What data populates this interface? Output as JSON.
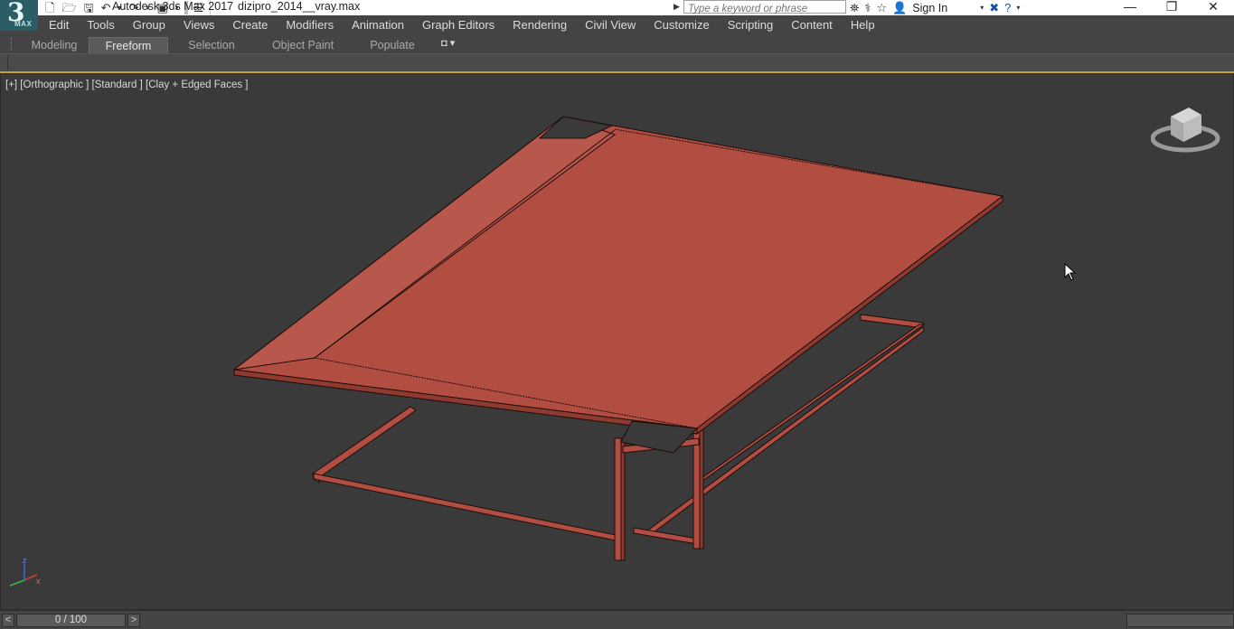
{
  "window": {
    "app_title": "Autodesk 3ds Max 2017",
    "file_name": "dizipro_2014__vray.max",
    "logo_big": "3",
    "logo_small": "MAX",
    "search_placeholder": "Type a keyword or phrase",
    "sign_in_label": "Sign In",
    "minimize_glyph": "—",
    "restore_glyph": "❐",
    "close_glyph": "✕"
  },
  "quick_access": {
    "icons": [
      "new-file-icon",
      "open-file-icon",
      "save-icon",
      "undo-icon",
      "redo-icon",
      "project-folder-icon"
    ]
  },
  "menu": {
    "items": [
      "Edit",
      "Tools",
      "Group",
      "Views",
      "Create",
      "Modifiers",
      "Animation",
      "Graph Editors",
      "Rendering",
      "Civil View",
      "Customize",
      "Scripting",
      "Content",
      "Help"
    ]
  },
  "ribbon": {
    "tabs": [
      "Modeling",
      "Freeform",
      "Selection",
      "Object Paint",
      "Populate"
    ],
    "active_tab": "Freeform"
  },
  "viewport": {
    "label": "[+] [Orthographic ] [Standard ] [Clay + Edged Faces ]",
    "axis_z": "z",
    "axis_x": "x",
    "background_color": "#3a3a3a",
    "model_color": "#b24d42"
  },
  "timeline": {
    "prev_label": "<",
    "next_label": ">",
    "frame_label": "0 / 100"
  },
  "colors": {
    "ribbon_accent": "#c8a03a",
    "active_tab_bg": "#5a5a5a"
  }
}
